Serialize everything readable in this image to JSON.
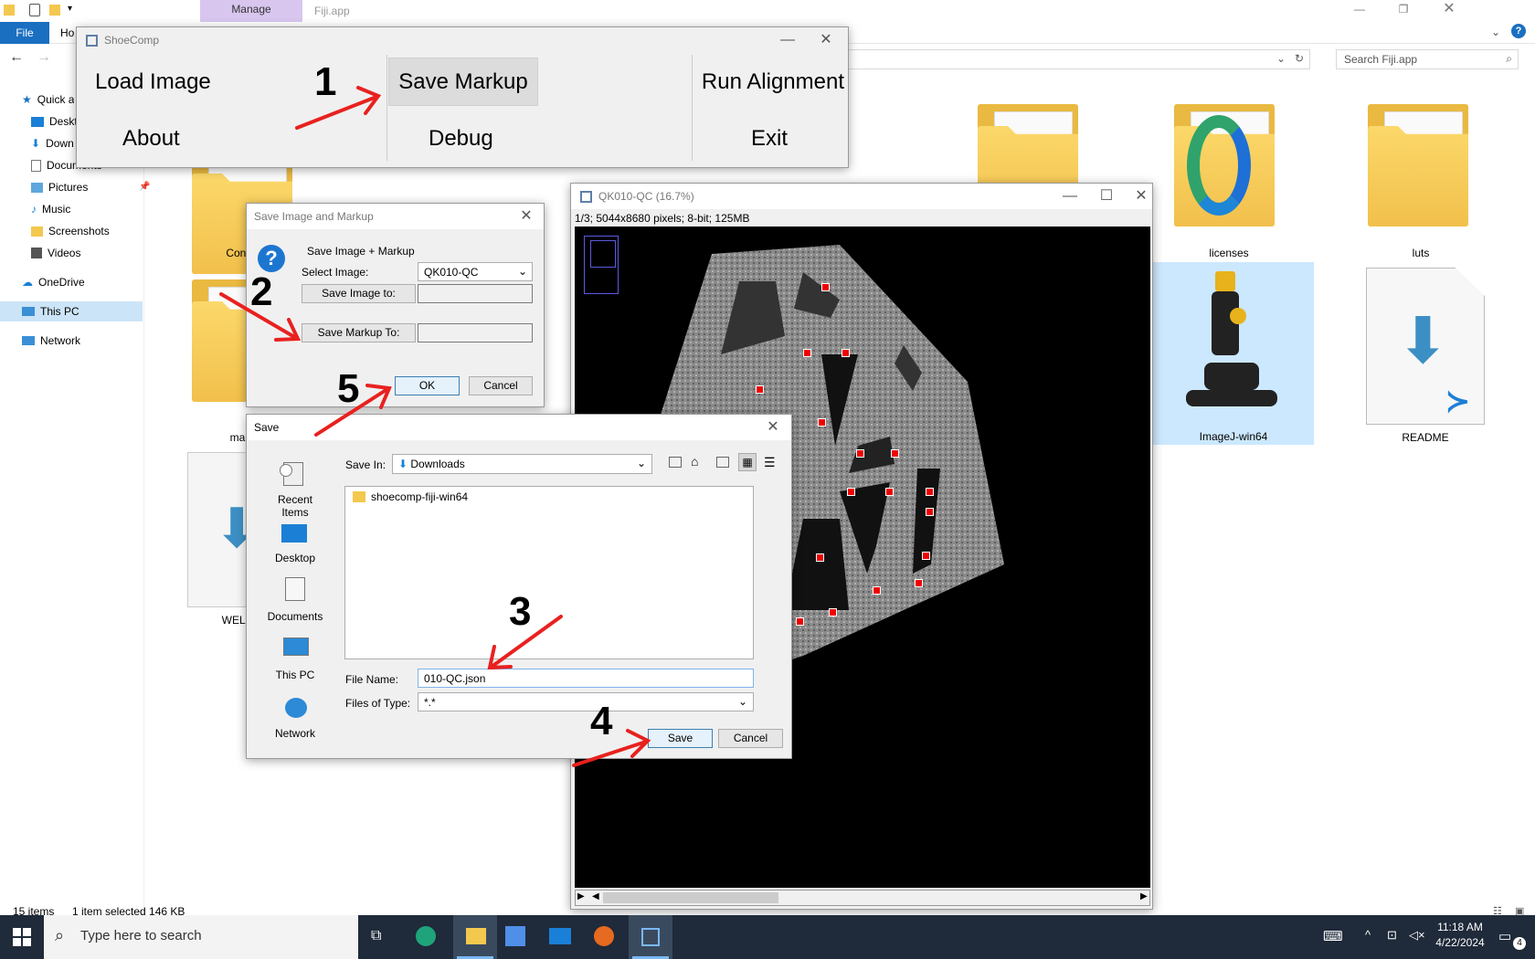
{
  "explorer": {
    "ribbon_tab_manage": "Manage",
    "window_title": "Fiji.app",
    "file_tab": "File",
    "home_tab": "Ho",
    "search_placeholder": "Search Fiji.app",
    "nav": [
      "Quick a",
      "Deskto",
      "Down",
      "Documents",
      "Pictures",
      "Music",
      "Screenshots",
      "Videos",
      "OneDrive",
      "This PC",
      "Network"
    ],
    "items": {
      "conf": "Conf",
      "ma": "ma",
      "welc": "WELC",
      "licenses": "licenses",
      "luts": "luts",
      "imagej": "ImageJ-win64",
      "readme": "README"
    },
    "status": {
      "count": "15 items",
      "selected": "1 item selected  146 KB"
    }
  },
  "shoecomp": {
    "title": "ShoeComp",
    "buttons": {
      "load": "Load Image",
      "save_markup": "Save Markup",
      "run": "Run Alignment",
      "about": "About",
      "debug": "Debug",
      "exit": "Exit"
    }
  },
  "qk_window": {
    "title": "QK010-QC (16.7%)",
    "info": "1/3; 5044x8680 pixels; 8-bit; 125MB"
  },
  "save_markup_dialog": {
    "title": "Save Image and Markup",
    "heading": "Save Image + Markup",
    "select_label": "Select Image:",
    "select_value": "QK010-QC",
    "save_image_btn": "Save Image to:",
    "save_markup_btn": "Save Markup To:",
    "ok": "OK",
    "cancel": "Cancel"
  },
  "save_dialog": {
    "title": "Save",
    "save_in_label": "Save In:",
    "save_in_value": "Downloads",
    "places": [
      "Recent Items",
      "Desktop",
      "Documents",
      "This PC",
      "Network"
    ],
    "files": [
      "shoecomp-fiji-win64"
    ],
    "file_name_label": "File Name:",
    "file_name_value": "010-QC.json",
    "files_of_type_label": "Files of Type:",
    "files_of_type_value": "*.*",
    "save": "Save",
    "cancel": "Cancel"
  },
  "annotations": {
    "n1": "1",
    "n2": "2",
    "n3": "3",
    "n4": "4",
    "n5": "5"
  },
  "taskbar": {
    "search_placeholder": "Type here to search",
    "time": "11:18 AM",
    "date": "4/22/2024",
    "notif_count": "4"
  },
  "colors": {
    "arrow": "#e8211f",
    "explorer_blue": "#0063b1",
    "taskbar": "#1f2a3a",
    "ok_border": "#3c7fb1"
  }
}
